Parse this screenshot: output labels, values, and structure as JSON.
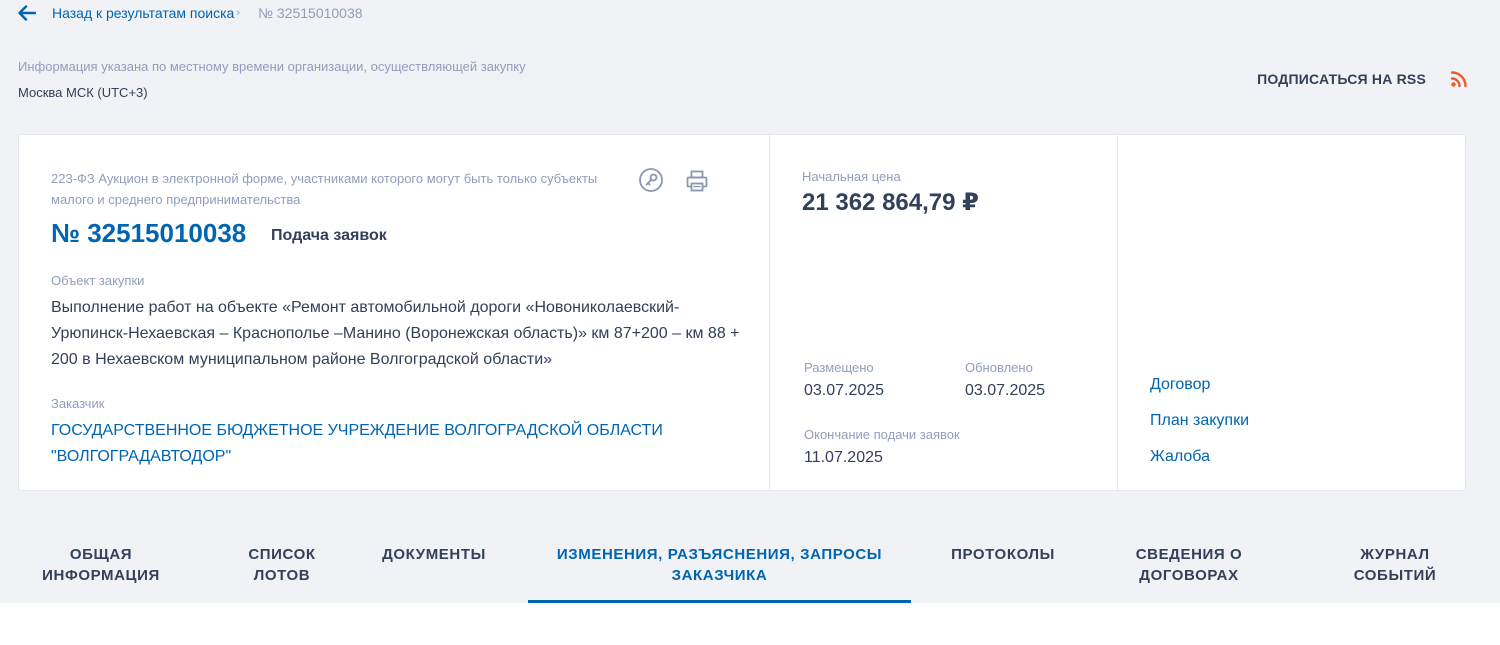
{
  "breadcrumb": {
    "back_label": "Назад к результатам поиска",
    "separator": "›",
    "current": "№ 32515010038"
  },
  "timezone": {
    "note": "Информация указана по местному времени организации, осуществляющей закупку",
    "value": "Москва МСК (UTC+3)"
  },
  "rss": {
    "label": "ПОДПИСАТЬСЯ НА RSS",
    "icon": "rss-icon",
    "color": "#f05a28"
  },
  "purchase": {
    "type": "223-ФЗ Аукцион в электронной форме, участниками которого могут быть только субъекты малого и среднего предпринимательства",
    "number": "№ 32515010038",
    "stage": "Подача заявок",
    "object_label": "Объект закупки",
    "object_text": "Выполнение работ на объекте «Ремонт автомобильной дороги «Новониколаевский-Урюпинск-Нехаевская – Краснополье –Манино (Воронежская область)» км 87+200 – км 88 + 200 в Нехаевском муниципальном районе Волгоградской области»",
    "customer_label": "Заказчик",
    "customer_name": "ГОСУДАРСТВЕННОЕ БЮДЖЕТНОЕ УЧРЕЖДЕНИЕ ВОЛГОГРАДСКОЙ ОБЛАСТИ \"ВОЛГОГРАДАВТОДОР\""
  },
  "price": {
    "label": "Начальная цена",
    "value": "21 362 864,79 ₽"
  },
  "dates": {
    "placed_label": "Размещено",
    "placed_value": "03.07.2025",
    "updated_label": "Обновлено",
    "updated_value": "03.07.2025",
    "deadline_label": "Окончание подачи заявок",
    "deadline_value": "11.07.2025"
  },
  "links": [
    "Договор",
    "План закупки",
    "Жалоба"
  ],
  "tabs": [
    {
      "line1": "ОБЩАЯ",
      "line2": "ИНФОРМАЦИЯ"
    },
    {
      "line1": "СПИСОК",
      "line2": "ЛОТОВ"
    },
    {
      "line1": "ДОКУМЕНТЫ",
      "line2": ""
    },
    {
      "line1": "ИЗМЕНЕНИЯ, РАЗЪЯСНЕНИЯ, ЗАПРОСЫ",
      "line2": "ЗАКАЗЧИКА"
    },
    {
      "line1": "ПРОТОКОЛЫ",
      "line2": ""
    },
    {
      "line1": "СВЕДЕНИЯ О",
      "line2": "ДОГОВОРАХ"
    },
    {
      "line1": "ЖУРНАЛ",
      "line2": "СОБЫТИЙ"
    }
  ],
  "active_tab_index": 3,
  "colors": {
    "accent": "#0065b1",
    "text": "#334059",
    "muted": "#909ebb",
    "background": "#f0f2f5"
  }
}
